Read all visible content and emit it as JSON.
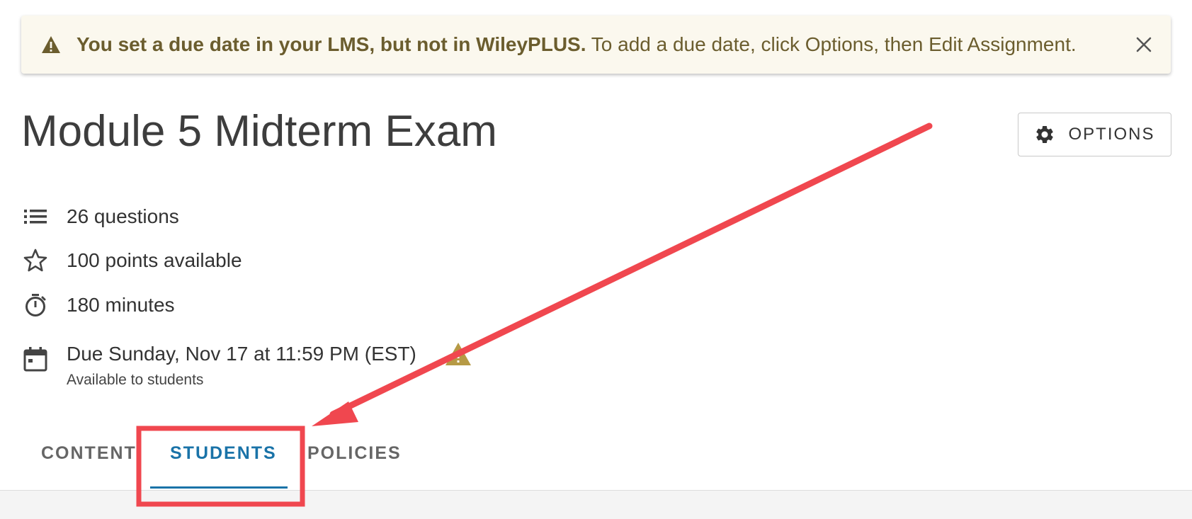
{
  "banner": {
    "bold_text": "You set a due date in your LMS, but not in WileyPLUS.",
    "text": " To add a due date, click Options, then Edit Assignment.",
    "icon": "warning-icon",
    "close_icon": "close-icon",
    "colors": {
      "background": "#fbf8ee",
      "text": "#6b5d2e"
    }
  },
  "assignment": {
    "title": "Module 5 Midterm Exam",
    "options_label": "OPTIONS",
    "options_icon": "gear-icon"
  },
  "details": {
    "questions": "26 questions",
    "points": "100 points available",
    "minutes": "180 minutes",
    "due": "Due Sunday, Nov 17 at 11:59 PM (EST)",
    "availability": "Available to students",
    "due_warning_icon": "warning-icon",
    "warning_color": "#b69a45"
  },
  "tabs": {
    "items": [
      {
        "label": "CONTENT"
      },
      {
        "label": "STUDENTS",
        "active": true
      },
      {
        "label": "POLICIES"
      }
    ],
    "active_color": "#1a73a8"
  },
  "annotation": {
    "arrow_color": "#f0474f",
    "highlight": "STUDENTS"
  }
}
